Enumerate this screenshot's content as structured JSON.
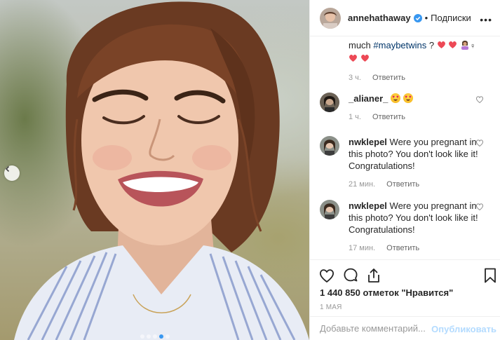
{
  "post": {
    "username": "annehathaway",
    "follow_label": "Подписки",
    "bullet": "•",
    "more": "•••",
    "carousel": {
      "total": 5,
      "current": 4
    }
  },
  "comments": {
    "caption_continuation": {
      "text_before": "much ",
      "hashtag": "#maybetwins",
      "text_after": " ?",
      "time": "3 ч.",
      "reply": "Ответить"
    },
    "items": [
      {
        "username": "_alianer_",
        "text": "",
        "time": "1 ч.",
        "reply": "Ответить"
      },
      {
        "username": "nwklepel",
        "text": "Were you pregnant in this photo? You don't look like it! Congratulations!",
        "time": "21 мин.",
        "reply": "Ответить"
      },
      {
        "username": "nwklepel",
        "text": "Were you pregnant in this photo? You don't look like it! Congratulations!",
        "time": "17 мин.",
        "reply": "Ответить"
      }
    ]
  },
  "likes": "1 440 850 отметок \"Нравится\"",
  "date": "1 МАЯ",
  "add_comment": {
    "placeholder": "Добавьте комментарий...",
    "publish": "Опубликовать"
  },
  "colors": {
    "link": "#003569",
    "publish": "#b3dbff",
    "verified": "#3897f0",
    "heart": "#ed4956"
  },
  "icons": [
    "chevron-left-icon",
    "verified-badge-icon",
    "heart-outline-icon",
    "comment-icon",
    "share-icon",
    "bookmark-icon",
    "red-heart-emoji",
    "heart-eyes-emoji",
    "woman-gesturing-emoji"
  ]
}
